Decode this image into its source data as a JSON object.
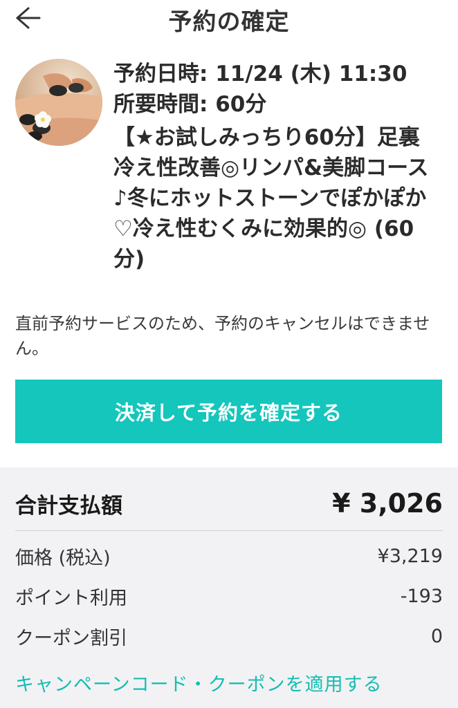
{
  "header": {
    "title": "予約の確定",
    "back_icon": "back-arrow-icon"
  },
  "booking": {
    "thumbnail_icon": "hot-stone-massage-photo",
    "datetime_line": "予約日時: 11/24 (木) 11:30",
    "duration_line": "所要時間: 60分",
    "course_name": "【★お試しみっちり60分】足裏冷え性改善◎リンパ&美脚コース♪冬にホットストーンでぽかぽか♡冷え性むくみに効果的◎ (60 分)"
  },
  "notice": "直前予約サービスのため、予約のキャンセルはできません。",
  "confirm_button": {
    "label": "決済して予約を確定する",
    "color": "#14c6bc"
  },
  "payment": {
    "total_label": "合計支払額",
    "total_amount": "¥ 3,026",
    "lines": [
      {
        "label": "価格 (税込)",
        "value": "¥3,219"
      },
      {
        "label": "ポイント利用",
        "value": "-193"
      },
      {
        "label": "クーポン割引",
        "value": "0"
      }
    ],
    "coupon_link": "キャンペーンコード・クーポンを適用する",
    "link_color": "#14bdb3",
    "background": "#f2f2f4"
  }
}
